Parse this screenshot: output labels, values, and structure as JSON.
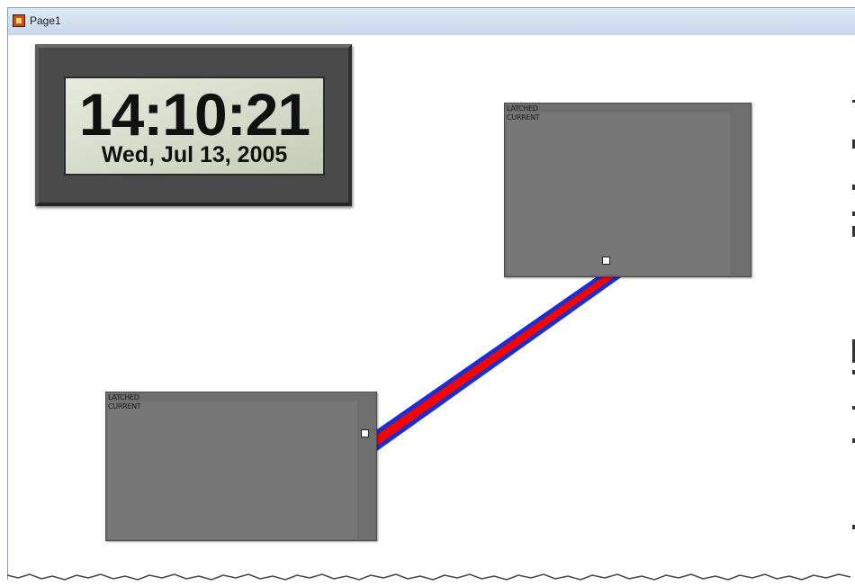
{
  "window": {
    "title": "Page1"
  },
  "clock": {
    "time": "14:10:21",
    "date": "Wed, Jul 13, 2005"
  },
  "panels": [
    {
      "label_line1": "LATCHED",
      "label_line2": "CURRENT"
    },
    {
      "label_line1": "LATCHED",
      "label_line2": "CURRENT"
    }
  ],
  "wire": {
    "outer_color": "#1b2fd0",
    "inner_color": "#ff0000"
  },
  "icons": {
    "app": "app-icon",
    "port": "port-icon"
  }
}
